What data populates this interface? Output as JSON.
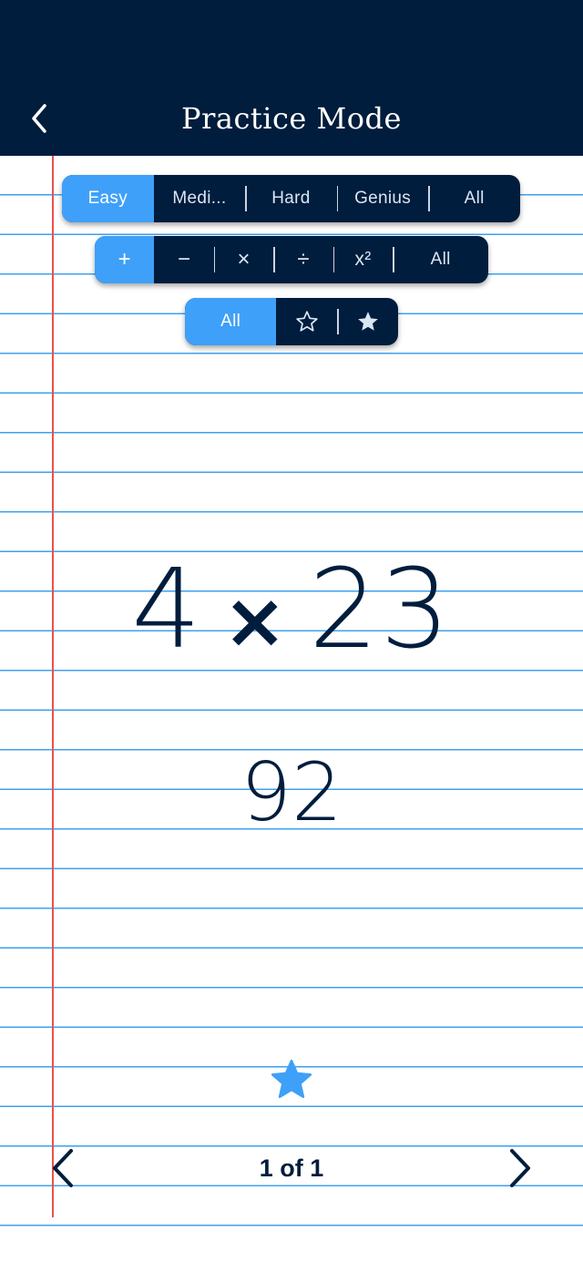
{
  "header": {
    "title": "Practice Mode",
    "back_icon": "chevron-left-icon"
  },
  "difficulty": {
    "items": [
      "Easy",
      "Medi...",
      "Hard",
      "Genius",
      "All"
    ],
    "selected": "Easy"
  },
  "operations": {
    "items": [
      "+",
      "−",
      "×",
      "÷",
      "x²",
      "All"
    ],
    "selected": "+"
  },
  "favorites": {
    "items": [
      "All",
      "star-outline-icon",
      "star-filled-icon"
    ],
    "all_label": "All",
    "selected": "All"
  },
  "problem": {
    "left": "4",
    "operator": "×",
    "right": "23",
    "answer": "92"
  },
  "favorite_icon": "star-filled-icon",
  "pagination": {
    "label": "1 of 1",
    "prev_icon": "chevron-left-icon",
    "next_icon": "chevron-right-icon"
  },
  "colors": {
    "navy": "#001d3d",
    "accent_blue": "#3ea0f8",
    "rule_blue": "#3ea0ee",
    "margin_red": "#e8504f"
  }
}
